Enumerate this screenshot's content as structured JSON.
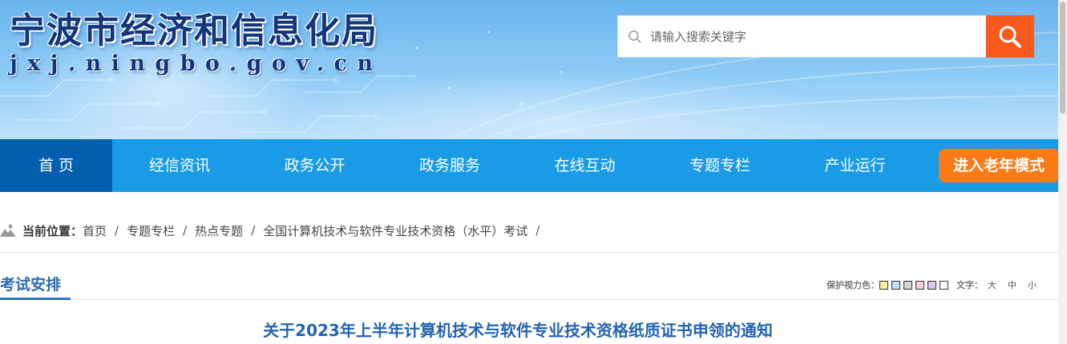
{
  "header": {
    "site_title": "宁波市经济和信息化局",
    "site_domain": "jxj.ningbo.gov.cn",
    "search_placeholder": "请输入搜索关键字"
  },
  "nav": {
    "items": [
      {
        "label": "首 页",
        "active": true
      },
      {
        "label": "经信资讯"
      },
      {
        "label": "政务公开"
      },
      {
        "label": "政务服务"
      },
      {
        "label": "在线互动"
      },
      {
        "label": "专题专栏"
      },
      {
        "label": "产业运行"
      }
    ],
    "elder_mode": "进入老年模式"
  },
  "breadcrumb": {
    "label": "当前位置：",
    "items": [
      "首页",
      "专题专栏",
      "热点专题",
      "全国计算机技术与软件专业技术资格（水平）考试"
    ],
    "separator": "/"
  },
  "section": {
    "tab": "考试安排"
  },
  "tools": {
    "eye_protect_label": "保护视力色：",
    "swatches": [
      "#fbf0a0",
      "#b9e2f8",
      "#d4d4d4",
      "#f7d0dc",
      "#d8c7f5",
      "#ffffff"
    ],
    "font_size_label": "文字：",
    "font_sizes": [
      "大",
      "中",
      "小"
    ]
  },
  "article": {
    "title": "关于2023年上半年计算机技术与软件专业技术资格纸质证书申领的通知"
  },
  "colors": {
    "nav_bg": "#1a9be6",
    "nav_active": "#045fb0",
    "accent_orange": "#fa5a1e",
    "title_blue": "#2364b0"
  }
}
